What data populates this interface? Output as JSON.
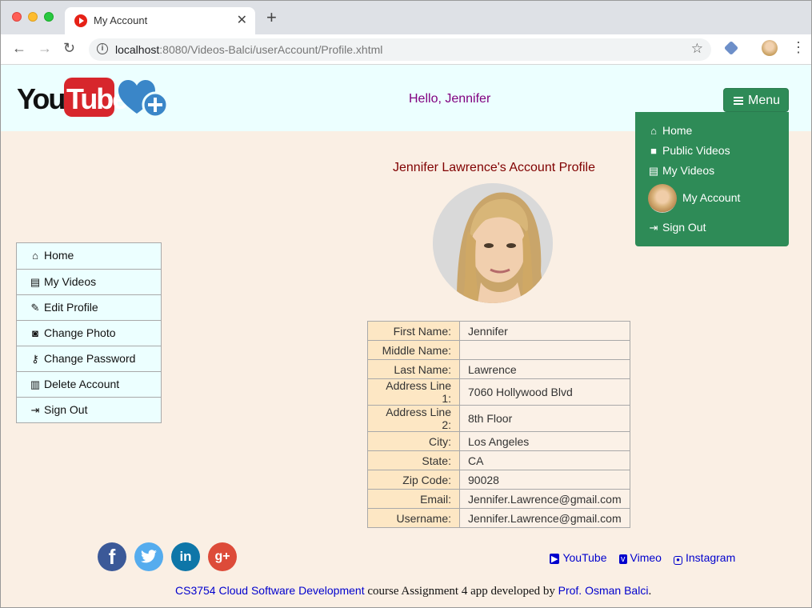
{
  "browser": {
    "tab_title": "My Account",
    "url_host": "localhost",
    "url_rest": ":8080/Videos-Balci/userAccount/Profile.xhtml"
  },
  "header": {
    "logo_you": "You",
    "logo_tube": "Tube",
    "greeting": "Hello, Jennifer",
    "menu_label": "Menu"
  },
  "dropdown": {
    "items": [
      {
        "label": "Home",
        "icon": "home-icon"
      },
      {
        "label": "Public Videos",
        "icon": "video-camera-icon"
      },
      {
        "label": "My Videos",
        "icon": "file-icon"
      },
      {
        "label": "My Account",
        "icon": "avatar"
      },
      {
        "label": "Sign Out",
        "icon": "sign-out-icon"
      }
    ]
  },
  "sidenav": {
    "items": [
      {
        "label": "Home",
        "icon": "home-icon"
      },
      {
        "label": "My Videos",
        "icon": "file-icon"
      },
      {
        "label": "Edit Profile",
        "icon": "edit-icon"
      },
      {
        "label": "Change Photo",
        "icon": "camera-icon"
      },
      {
        "label": "Change Password",
        "icon": "key-icon"
      },
      {
        "label": "Delete Account",
        "icon": "trash-icon"
      },
      {
        "label": "Sign Out",
        "icon": "sign-out-icon"
      }
    ]
  },
  "profile": {
    "title": "Jennifer Lawrence's Account Profile",
    "rows": [
      {
        "label": "First Name:",
        "value": "Jennifer"
      },
      {
        "label": "Middle Name:",
        "value": ""
      },
      {
        "label": "Last Name:",
        "value": "Lawrence"
      },
      {
        "label": "Address Line 1:",
        "value": "7060 Hollywood Blvd"
      },
      {
        "label": "Address Line 2:",
        "value": "8th Floor"
      },
      {
        "label": "City:",
        "value": "Los Angeles"
      },
      {
        "label": "State:",
        "value": "CA"
      },
      {
        "label": "Zip Code:",
        "value": "90028"
      },
      {
        "label": "Email:",
        "value": "Jennifer.Lawrence@gmail.com"
      },
      {
        "label": "Username:",
        "value": "Jennifer.Lawrence@gmail.com"
      }
    ]
  },
  "footer": {
    "social": [
      {
        "glyph": "f",
        "icon": "facebook-icon"
      },
      {
        "glyph": "🐦",
        "icon": "twitter-icon"
      },
      {
        "glyph": "in",
        "icon": "linkedin-icon"
      },
      {
        "glyph": "g+",
        "icon": "google-plus-icon"
      }
    ],
    "links": {
      "youtube": "YouTube",
      "vimeo": "Vimeo",
      "instagram": "Instagram"
    },
    "credits": {
      "course": "CS3754 Cloud Software Development",
      "middle": " course Assignment 4 app developed by ",
      "author": "Prof. Osman Balci",
      "end": "."
    }
  },
  "colors": {
    "header_bg": "#ecffff",
    "page_bg": "#faefe4",
    "menu_green": "#2e8b57",
    "greeting": "#800080",
    "title": "#800000",
    "link": "#0000cd"
  }
}
